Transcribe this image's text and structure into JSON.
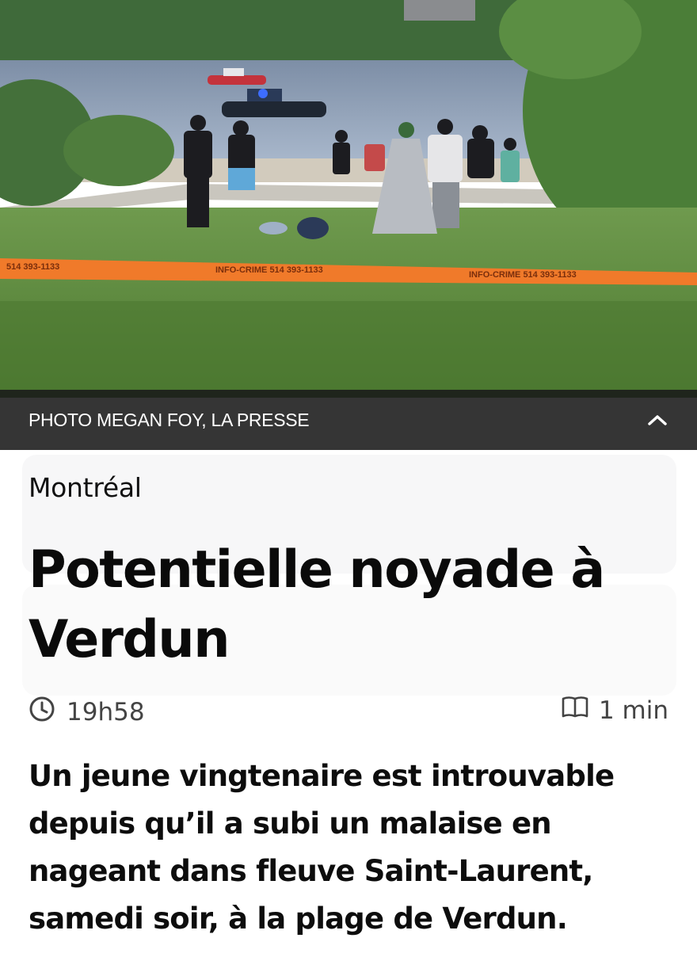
{
  "photo": {
    "caption": "PHOTO MEGAN FOY, LA PRESSE",
    "tape_text_1": "INFO-CRIME 514 393-1133",
    "tape_text_2": "INFO-CRIME 514 393-1133",
    "tape_text_3": "514 393-1133"
  },
  "article": {
    "section": "Montréal",
    "title": "Potentielle noyade à Verdun",
    "time": "19h58",
    "read_time": "1 min",
    "lead": "Un jeune vingtenaire est introuvable depuis qu’il a subi un malaise en nageant dans fleuve Saint-Laurent, samedi soir, à la plage de Verdun."
  },
  "icons": {
    "caption_toggle": "chevron-up-icon",
    "time": "clock-icon",
    "read_time": "book-icon"
  },
  "colors": {
    "caption_bar": "#191919",
    "police_tape": "#f07a2a",
    "title_text": "#0a0a0a"
  }
}
